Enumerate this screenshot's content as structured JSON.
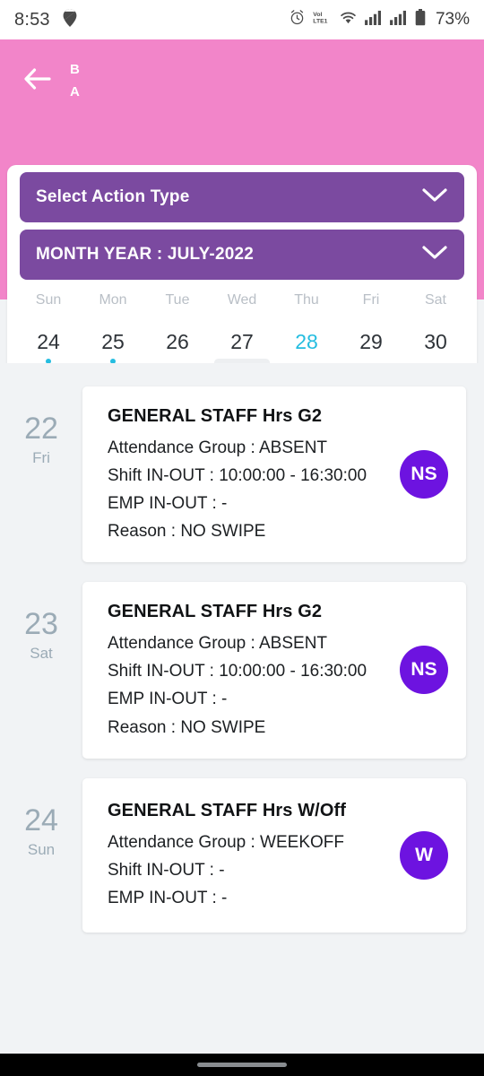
{
  "status_bar": {
    "time": "8:53",
    "battery_text": "73%",
    "icons": [
      "location-pin-icon",
      "alarm-icon",
      "volte-icon",
      "wifi-icon",
      "signal-icon-1",
      "signal-icon-2",
      "battery-icon"
    ]
  },
  "header": {
    "back_icon": "back-arrow-icon",
    "title": "B",
    "subtitle": "A",
    "background_color": "#F285C9"
  },
  "selectors": {
    "action_type": {
      "label": "Select Action Type",
      "chevron_icon": "chevron-down-icon"
    },
    "month_year": {
      "label": "MONTH YEAR : JULY-2022",
      "chevron_icon": "chevron-down-icon"
    },
    "background_color": "#7B4AA0"
  },
  "week_strip": {
    "day_names": [
      "Sun",
      "Mon",
      "Tue",
      "Wed",
      "Thu",
      "Fri",
      "Sat"
    ],
    "days": [
      {
        "date": "24",
        "selected": false,
        "dot": true
      },
      {
        "date": "25",
        "selected": false,
        "dot": true
      },
      {
        "date": "26",
        "selected": false,
        "dot": false
      },
      {
        "date": "27",
        "selected": false,
        "dot": false
      },
      {
        "date": "28",
        "selected": true,
        "dot": false
      },
      {
        "date": "29",
        "selected": false,
        "dot": false
      },
      {
        "date": "30",
        "selected": false,
        "dot": false
      }
    ],
    "selected_color": "#25BDE0",
    "drag_handle": "drag-handle"
  },
  "entries": [
    {
      "date_num": "22",
      "date_dow": "Fri",
      "title": "GENERAL STAFF Hrs G2",
      "attendance_group": "Attendance Group : ABSENT",
      "shift_in_out": "Shift IN-OUT : 10:00:00 - 16:30:00",
      "emp_in_out": "EMP IN-OUT :  -",
      "reason": "Reason : NO SWIPE",
      "badge": "NS",
      "badge_color": "#6D13E0"
    },
    {
      "date_num": "23",
      "date_dow": "Sat",
      "title": "GENERAL STAFF Hrs G2",
      "attendance_group": "Attendance Group : ABSENT",
      "shift_in_out": "Shift IN-OUT : 10:00:00 - 16:30:00",
      "emp_in_out": "EMP IN-OUT :  -",
      "reason": "Reason : NO SWIPE",
      "badge": "NS",
      "badge_color": "#6D13E0"
    },
    {
      "date_num": "24",
      "date_dow": "Sun",
      "title": "GENERAL STAFF Hrs W/Off",
      "attendance_group": "Attendance Group : WEEKOFF",
      "shift_in_out": "Shift IN-OUT :  -",
      "emp_in_out": "EMP IN-OUT :  -",
      "reason": "",
      "badge": "W",
      "badge_color": "#6D13E0"
    }
  ],
  "nav_bar": {
    "home_indicator": "home-indicator"
  }
}
